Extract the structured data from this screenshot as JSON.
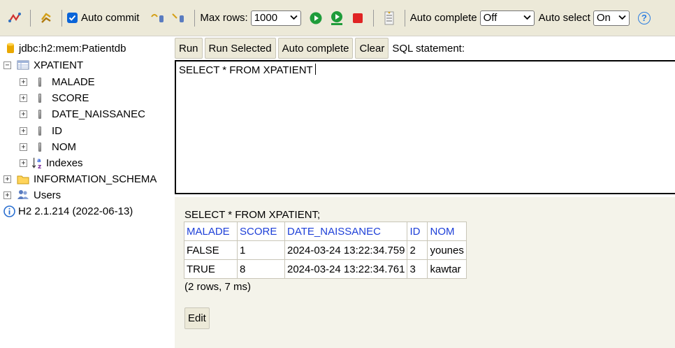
{
  "toolbar": {
    "auto_commit_label": "Auto commit",
    "auto_commit_checked": true,
    "max_rows_label": "Max rows:",
    "max_rows_value": "1000",
    "auto_complete_label": "Auto complete",
    "auto_complete_value": "Off",
    "auto_select_label": "Auto select",
    "auto_select_value": "On",
    "help_glyph": "?",
    "icons": [
      "disconnect-icon",
      "refresh-icon",
      "rollback-icon",
      "commit-icon",
      "run-icon",
      "run-selected-icon",
      "stop-icon",
      "history-icon",
      "help-icon"
    ]
  },
  "tree": {
    "connection": "jdbc:h2:mem:Patientdb",
    "table": {
      "name": "XPATIENT",
      "columns": [
        "MALADE",
        "SCORE",
        "DATE_NAISSANEC",
        "ID",
        "NOM"
      ],
      "indexes_label": "Indexes"
    },
    "schema": "INFORMATION_SCHEMA",
    "users": "Users",
    "version": "H2 2.1.214 (2022-06-13)",
    "expand_glyph": "+",
    "collapse_glyph": "−"
  },
  "editor": {
    "buttons": {
      "run": "Run",
      "run_selected": "Run Selected",
      "auto_complete": "Auto complete",
      "clear": "Clear"
    },
    "label": "SQL statement:",
    "sql": "SELECT * FROM XPATIENT"
  },
  "result": {
    "query": "SELECT * FROM XPATIENT;",
    "headers": [
      "MALADE",
      "SCORE",
      "DATE_NAISSANEC",
      "ID",
      "NOM"
    ],
    "rows": [
      [
        "FALSE",
        "1",
        "2024-03-24 13:22:34.759",
        "2",
        "younes"
      ],
      [
        "TRUE",
        "8",
        "2024-03-24 13:22:34.761",
        "3",
        "kawtar"
      ]
    ],
    "summary": "(2 rows, 7 ms)",
    "edit_label": "Edit"
  },
  "colors": {
    "toolbar_bg": "#ece9d8",
    "header_link": "#1d3fd8",
    "results_bg": "#f4f3ea",
    "run_green": "#1f9c3a",
    "stop_red": "#e02424",
    "check_blue": "#0a64d8",
    "help_blue": "#2a7de1"
  }
}
